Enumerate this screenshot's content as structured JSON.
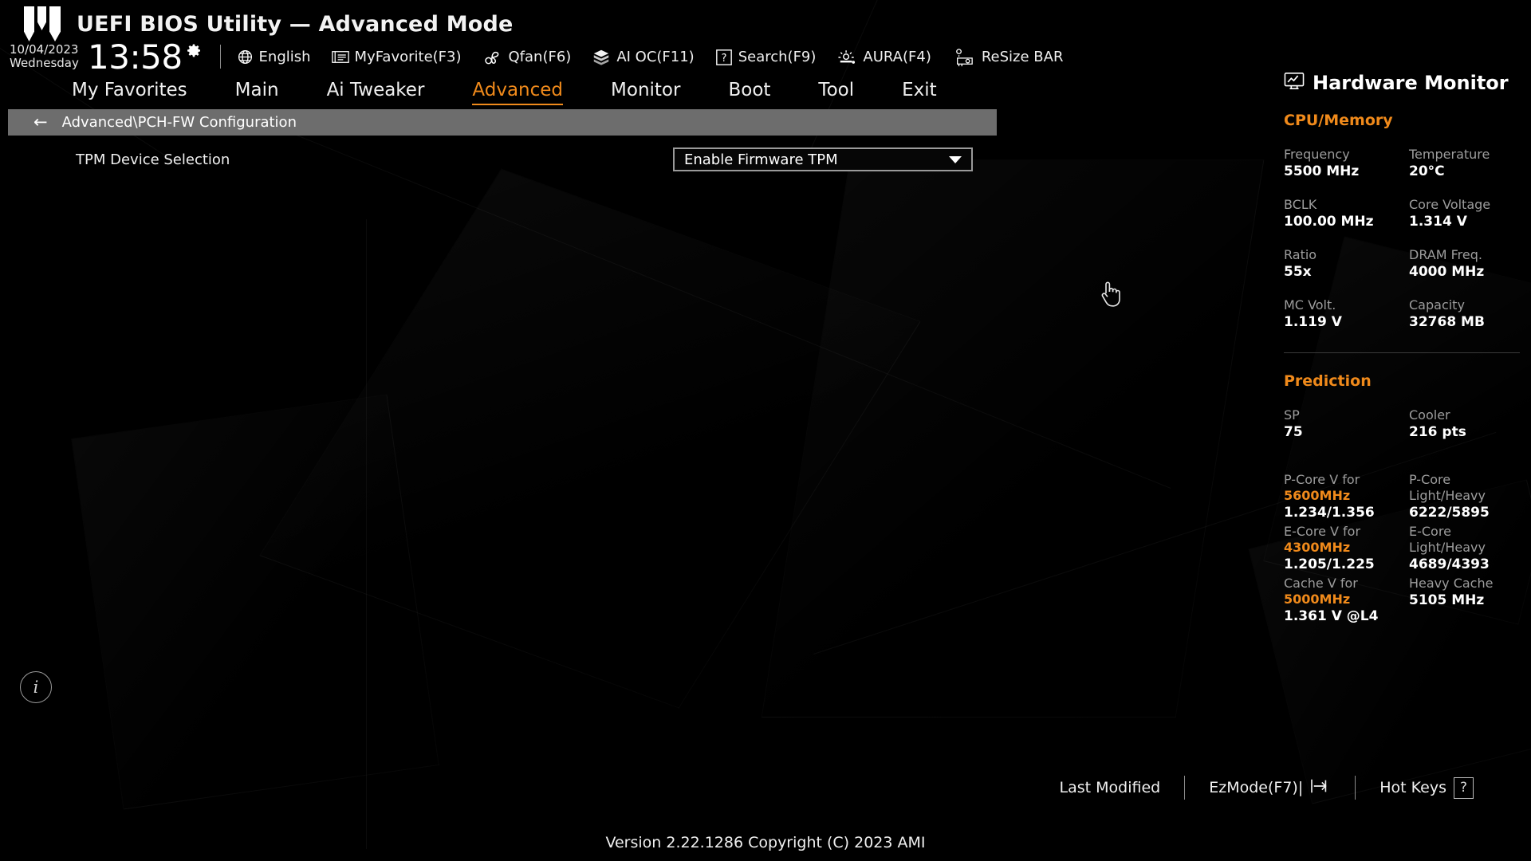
{
  "header": {
    "title": "UEFI BIOS Utility — Advanced Mode",
    "logo_icon": "tuf-gaming-logo",
    "date": "10/04/2023",
    "weekday": "Wednesday",
    "time": "13:58",
    "clock_gear_icon": "gear-icon",
    "tools": [
      {
        "label": "English",
        "icon": "globe-icon"
      },
      {
        "label": "MyFavorite(F3)",
        "icon": "favorites-list-icon"
      },
      {
        "label": "Qfan(F6)",
        "icon": "fan-icon"
      },
      {
        "label": "AI OC(F11)",
        "icon": "brain-icon"
      },
      {
        "label": "Search(F9)",
        "icon": "question-box-icon"
      },
      {
        "label": "AURA(F4)",
        "icon": "aura-light-icon"
      },
      {
        "label": "ReSize BAR",
        "icon": "gpu-card-icon"
      }
    ]
  },
  "nav": {
    "tabs": [
      {
        "label": "My Favorites",
        "active": false
      },
      {
        "label": "Main",
        "active": false
      },
      {
        "label": "Ai Tweaker",
        "active": false
      },
      {
        "label": "Advanced",
        "active": true
      },
      {
        "label": "Monitor",
        "active": false
      },
      {
        "label": "Boot",
        "active": false
      },
      {
        "label": "Tool",
        "active": false
      },
      {
        "label": "Exit",
        "active": false
      }
    ]
  },
  "breadcrumb": {
    "back_icon": "back-arrow-icon",
    "path": "Advanced\\PCH-FW Configuration"
  },
  "main": {
    "settings": [
      {
        "label": "TPM Device Selection",
        "value": "Enable Firmware TPM",
        "control": "dropdown"
      }
    ],
    "info_icon": "info-icon"
  },
  "hardware_monitor": {
    "icon": "monitor-chart-icon",
    "title": "Hardware Monitor",
    "sections": [
      {
        "name": "CPU/Memory",
        "items": [
          {
            "key": "Frequency",
            "value": "5500 MHz"
          },
          {
            "key": "Temperature",
            "value": "20°C"
          },
          {
            "key": "BCLK",
            "value": "100.00 MHz"
          },
          {
            "key": "Core Voltage",
            "value": "1.314 V"
          },
          {
            "key": "Ratio",
            "value": "55x"
          },
          {
            "key": "DRAM Freq.",
            "value": "4000 MHz"
          },
          {
            "key": "MC Volt.",
            "value": "1.119 V"
          },
          {
            "key": "Capacity",
            "value": "32768 MB"
          }
        ]
      },
      {
        "name": "Prediction",
        "items": [
          {
            "key": "SP",
            "value": "75"
          },
          {
            "key": "Cooler",
            "value": "216 pts"
          }
        ],
        "detail_items": [
          {
            "key_pre": "P-Core V for ",
            "key_hl": "5600MHz",
            "value": "1.234/1.356"
          },
          {
            "key_pre": "P-Core Light/Heavy",
            "key_hl": "",
            "value": "6222/5895"
          },
          {
            "key_pre": "E-Core V for ",
            "key_hl": "4300MHz",
            "value": "1.205/1.225"
          },
          {
            "key_pre": "E-Core Light/Heavy",
            "key_hl": "",
            "value": "4689/4393"
          },
          {
            "key_pre": "Cache V for ",
            "key_hl": "5000MHz",
            "value": "1.361 V @L4"
          },
          {
            "key_pre": "Heavy Cache",
            "key_hl": "",
            "value": "5105 MHz"
          }
        ]
      }
    ]
  },
  "footer": {
    "last_modified": "Last Modified",
    "ezmode": "EzMode(F7)|",
    "ezmode_icon": "exit-arrow-icon",
    "hotkeys": "Hot Keys",
    "hotkeys_key": "?",
    "version": "Version 2.22.1286 Copyright (C) 2023 AMI"
  },
  "cursor": {
    "icon": "hand-pointer-cursor"
  },
  "colors": {
    "accent": "#f08a1b",
    "background": "#000000",
    "breadcrumb_bg": "#6d6d6d",
    "label_grey": "#9d9d9d"
  }
}
